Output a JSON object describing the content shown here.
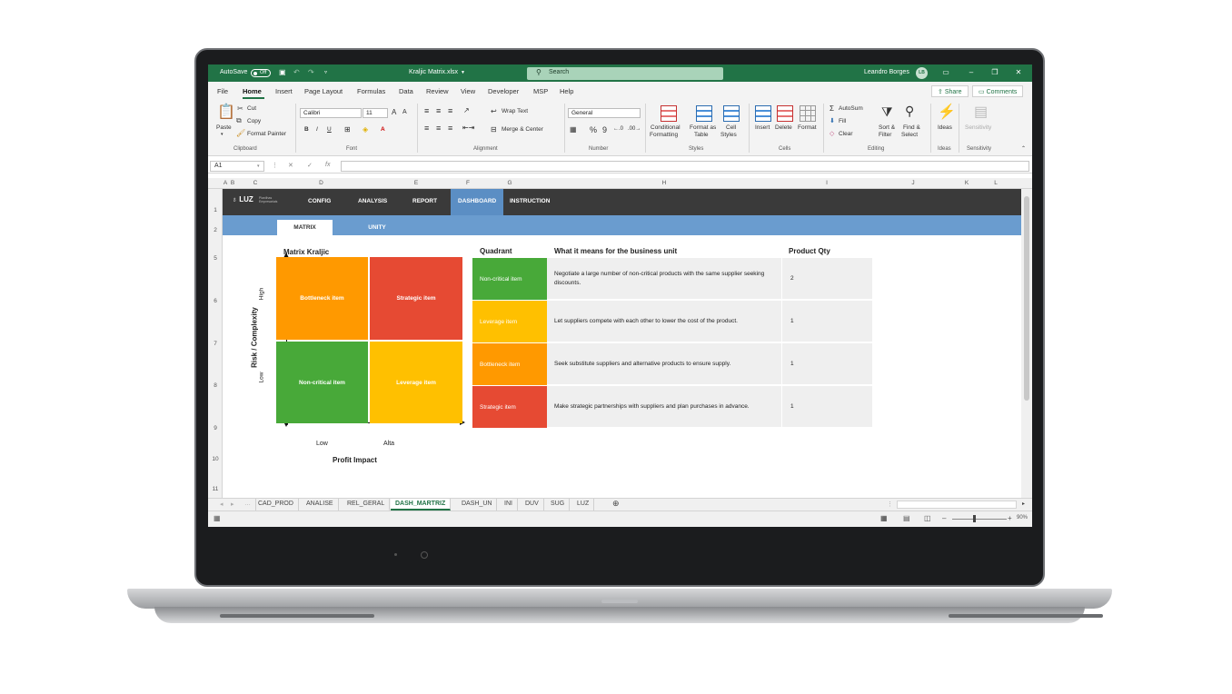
{
  "window": {
    "autosave_label": "AutoSave",
    "autosave_state": "Off",
    "file_name": "Kraljic Matrix.xlsx",
    "search_placeholder": "Search",
    "user_name": "Leandro Borges",
    "user_initials": "LB",
    "accent_color": "#217346"
  },
  "menu": {
    "items": [
      "File",
      "Home",
      "Insert",
      "Page Layout",
      "Formulas",
      "Data",
      "Review",
      "View",
      "Developer",
      "MSP",
      "Help"
    ],
    "active": "Home",
    "share_label": "Share",
    "comments_label": "Comments"
  },
  "ribbon": {
    "clipboard": {
      "paste": "Paste",
      "cut": "Cut",
      "copy": "Copy",
      "format_painter": "Format Painter",
      "group": "Clipboard"
    },
    "font": {
      "name": "Calibri",
      "size": "11",
      "group": "Font"
    },
    "alignment": {
      "wrap_text": "Wrap Text",
      "merge_center": "Merge & Center",
      "group": "Alignment"
    },
    "number": {
      "format": "General",
      "group": "Number"
    },
    "styles": {
      "conditional_1": "Conditional",
      "conditional_2": "Formatting",
      "format_table_1": "Format as",
      "format_table_2": "Table",
      "cell_styles_1": "Cell",
      "cell_styles_2": "Styles",
      "group": "Styles"
    },
    "cells": {
      "insert": "Insert",
      "delete": "Delete",
      "format": "Format",
      "group": "Cells"
    },
    "editing": {
      "autosum": "AutoSum",
      "fill": "Fill",
      "clear": "Clear",
      "sort_1": "Sort &",
      "sort_2": "Filter",
      "find_1": "Find &",
      "find_2": "Select",
      "group": "Editing"
    },
    "ideas": {
      "label": "Ideas",
      "group": "Ideas"
    },
    "sensitivity": {
      "label": "Sensitivity",
      "group": "Sensitivity"
    }
  },
  "formula_bar": {
    "name_box": "A1",
    "fx": "fx"
  },
  "columns": [
    "A",
    "B",
    "C",
    "D",
    "E",
    "F",
    "G",
    "H",
    "I",
    "J",
    "K",
    "L"
  ],
  "rows": [
    "1",
    "2",
    "5",
    "6",
    "7",
    "8",
    "9",
    "10",
    "11"
  ],
  "dashboard": {
    "logo": "LUZ",
    "logo_sub_1": "Planilhas",
    "logo_sub_2": "Empresariais",
    "nav": [
      "CONFIG",
      "ANALYSIS",
      "REPORT",
      "DASHBOARD",
      "INSTRUCTION"
    ],
    "nav_active": "DASHBOARD",
    "subtabs": [
      "MATRIX",
      "UNITY"
    ],
    "subtab_active": "MATRIX",
    "nav_bg": "#3a3a3a",
    "nav_active_bg": "#5b8ec4",
    "subbar_bg": "#6a9ccf"
  },
  "matrix": {
    "title": "Matrix Kraljic",
    "y_axis_label": "Risk / Complexity",
    "x_axis_label": "Profit Impact",
    "y_high": "High",
    "y_low": "Low",
    "x_low": "Low",
    "x_high": "Alta",
    "cells": [
      {
        "label": "Bottleneck item",
        "color": "#ff9900"
      },
      {
        "label": "Strategic item",
        "color": "#e64a33"
      },
      {
        "label": "Non-critical item",
        "color": "#48a939"
      },
      {
        "label": "Leverage item",
        "color": "#ffc000"
      }
    ]
  },
  "table": {
    "headers": [
      "Quadrant",
      "What it means for the business unit",
      "Product Qty"
    ],
    "rows": [
      {
        "quadrant": "Non-critical item",
        "color": "#48a939",
        "meaning": "Negotiate a large number of non-critical products with the same supplier seeking discounts.",
        "qty": "2"
      },
      {
        "quadrant": "Leverage item",
        "color": "#ffc000",
        "meaning": "Let suppliers compete with each other to lower the cost of the product.",
        "qty": "1"
      },
      {
        "quadrant": "Bottleneck item",
        "color": "#ff9900",
        "meaning": "Seek substitute suppliers and alternative products to ensure supply.",
        "qty": "1"
      },
      {
        "quadrant": "Strategic item",
        "color": "#e64a33",
        "meaning": "Make strategic partnerships with suppliers and plan purchases in advance.",
        "qty": "1"
      }
    ]
  },
  "sheet_tabs": [
    "CAD_PROD",
    "ANALISE",
    "REL_GERAL",
    "DASH_MARTRIZ",
    "DASH_UN",
    "INI",
    "DUV",
    "SUG",
    "LUZ"
  ],
  "sheet_tab_active": "DASH_MARTRIZ",
  "status": {
    "zoom": "90%"
  }
}
